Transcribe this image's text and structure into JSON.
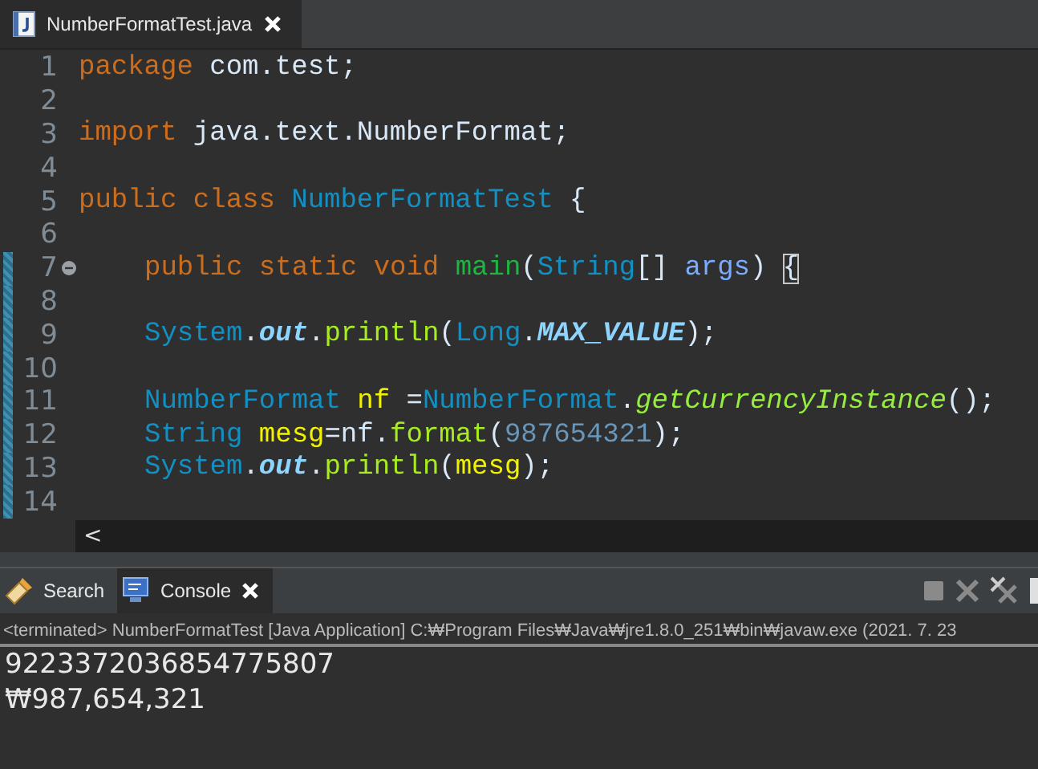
{
  "editor_tab": {
    "title": "NumberFormatTest.java",
    "selected": true
  },
  "code": [
    {
      "number": "1",
      "changed": false,
      "fold": false,
      "indented": false,
      "tokens": [
        {
          "kind": "keyword",
          "text": "package"
        },
        {
          "kind": "plain",
          "text": " com.test;"
        }
      ]
    },
    {
      "number": "2",
      "changed": false,
      "fold": false
    },
    {
      "number": "3",
      "changed": false,
      "fold": false,
      "indented": false,
      "tokens": [
        {
          "kind": "keyword",
          "text": "import"
        },
        {
          "kind": "plain",
          "text": " java.text.NumberFormat;"
        }
      ]
    },
    {
      "number": "4",
      "changed": false,
      "fold": false
    },
    {
      "number": "5",
      "changed": false,
      "fold": false,
      "indented": false,
      "tokens": [
        {
          "kind": "keyword",
          "text": "public class"
        },
        {
          "kind": "type",
          "text": " NumberFormatTest"
        },
        {
          "kind": "plain",
          "text": " {"
        }
      ]
    },
    {
      "number": "6",
      "changed": false,
      "fold": false
    },
    {
      "number": "7",
      "changed": true,
      "fold": true,
      "indented": true,
      "tokens": [
        {
          "kind": "keyword",
          "text": "public static void"
        },
        {
          "kind": "method-declaration",
          "text": " main"
        },
        {
          "kind": "plain",
          "text": "("
        },
        {
          "kind": "type",
          "text": "String"
        },
        {
          "kind": "plain",
          "text": "[] "
        },
        {
          "kind": "parameter",
          "text": "args"
        },
        {
          "kind": "plain",
          "text": ") "
        },
        {
          "kind": "bracket-match",
          "text": "{"
        }
      ]
    },
    {
      "number": "8",
      "changed": true,
      "fold": false
    },
    {
      "number": "9",
      "changed": true,
      "fold": false,
      "indented": true,
      "tokens": [
        {
          "kind": "type",
          "text": "System"
        },
        {
          "kind": "plain",
          "text": "."
        },
        {
          "kind": "static-field",
          "text": "out"
        },
        {
          "kind": "plain",
          "text": "."
        },
        {
          "kind": "method",
          "text": "println"
        },
        {
          "kind": "plain",
          "text": "("
        },
        {
          "kind": "type",
          "text": "Long"
        },
        {
          "kind": "plain",
          "text": "."
        },
        {
          "kind": "static-field",
          "text": "MAX_VALUE"
        },
        {
          "kind": "plain",
          "text": ");"
        }
      ]
    },
    {
      "number": "10",
      "changed": true,
      "fold": false
    },
    {
      "number": "11",
      "changed": true,
      "fold": false,
      "indented": true,
      "tokens": [
        {
          "kind": "type",
          "text": "NumberFormat"
        },
        {
          "kind": "variable",
          "text": " nf"
        },
        {
          "kind": "plain",
          "text": " ="
        },
        {
          "kind": "type",
          "text": "NumberFormat"
        },
        {
          "kind": "plain",
          "text": "."
        },
        {
          "kind": "static-method",
          "text": "getCurrencyInstance"
        },
        {
          "kind": "plain",
          "text": "();"
        }
      ]
    },
    {
      "number": "12",
      "changed": true,
      "fold": false,
      "indented": true,
      "tokens": [
        {
          "kind": "type",
          "text": "String"
        },
        {
          "kind": "variable",
          "text": " mesg"
        },
        {
          "kind": "plain",
          "text": "=nf."
        },
        {
          "kind": "method",
          "text": "format"
        },
        {
          "kind": "plain",
          "text": "("
        },
        {
          "kind": "number",
          "text": "987654321"
        },
        {
          "kind": "plain",
          "text": ");"
        }
      ]
    },
    {
      "number": "13",
      "changed": true,
      "fold": false,
      "indented": true,
      "tokens": [
        {
          "kind": "type",
          "text": "System"
        },
        {
          "kind": "plain",
          "text": "."
        },
        {
          "kind": "static-field",
          "text": "out"
        },
        {
          "kind": "plain",
          "text": "."
        },
        {
          "kind": "method",
          "text": "println"
        },
        {
          "kind": "plain",
          "text": "("
        },
        {
          "kind": "variable",
          "text": "mesg"
        },
        {
          "kind": "plain",
          "text": ");"
        }
      ]
    },
    {
      "number": "14",
      "changed": true,
      "fold": false
    }
  ],
  "scroll_left": "<",
  "view_tabs": [
    {
      "kind": "search",
      "label": "Search",
      "selected": false,
      "closable": false
    },
    {
      "kind": "console",
      "label": "Console",
      "selected": true,
      "closable": true
    }
  ],
  "console": {
    "header": "<terminated> NumberFormatTest [Java Application] C:₩Program Files₩Java₩jre1.8.0_251₩bin₩javaw.exe  (2021. 7. 23",
    "output": [
      "9223372036854775807",
      "₩987,654,321"
    ]
  }
}
